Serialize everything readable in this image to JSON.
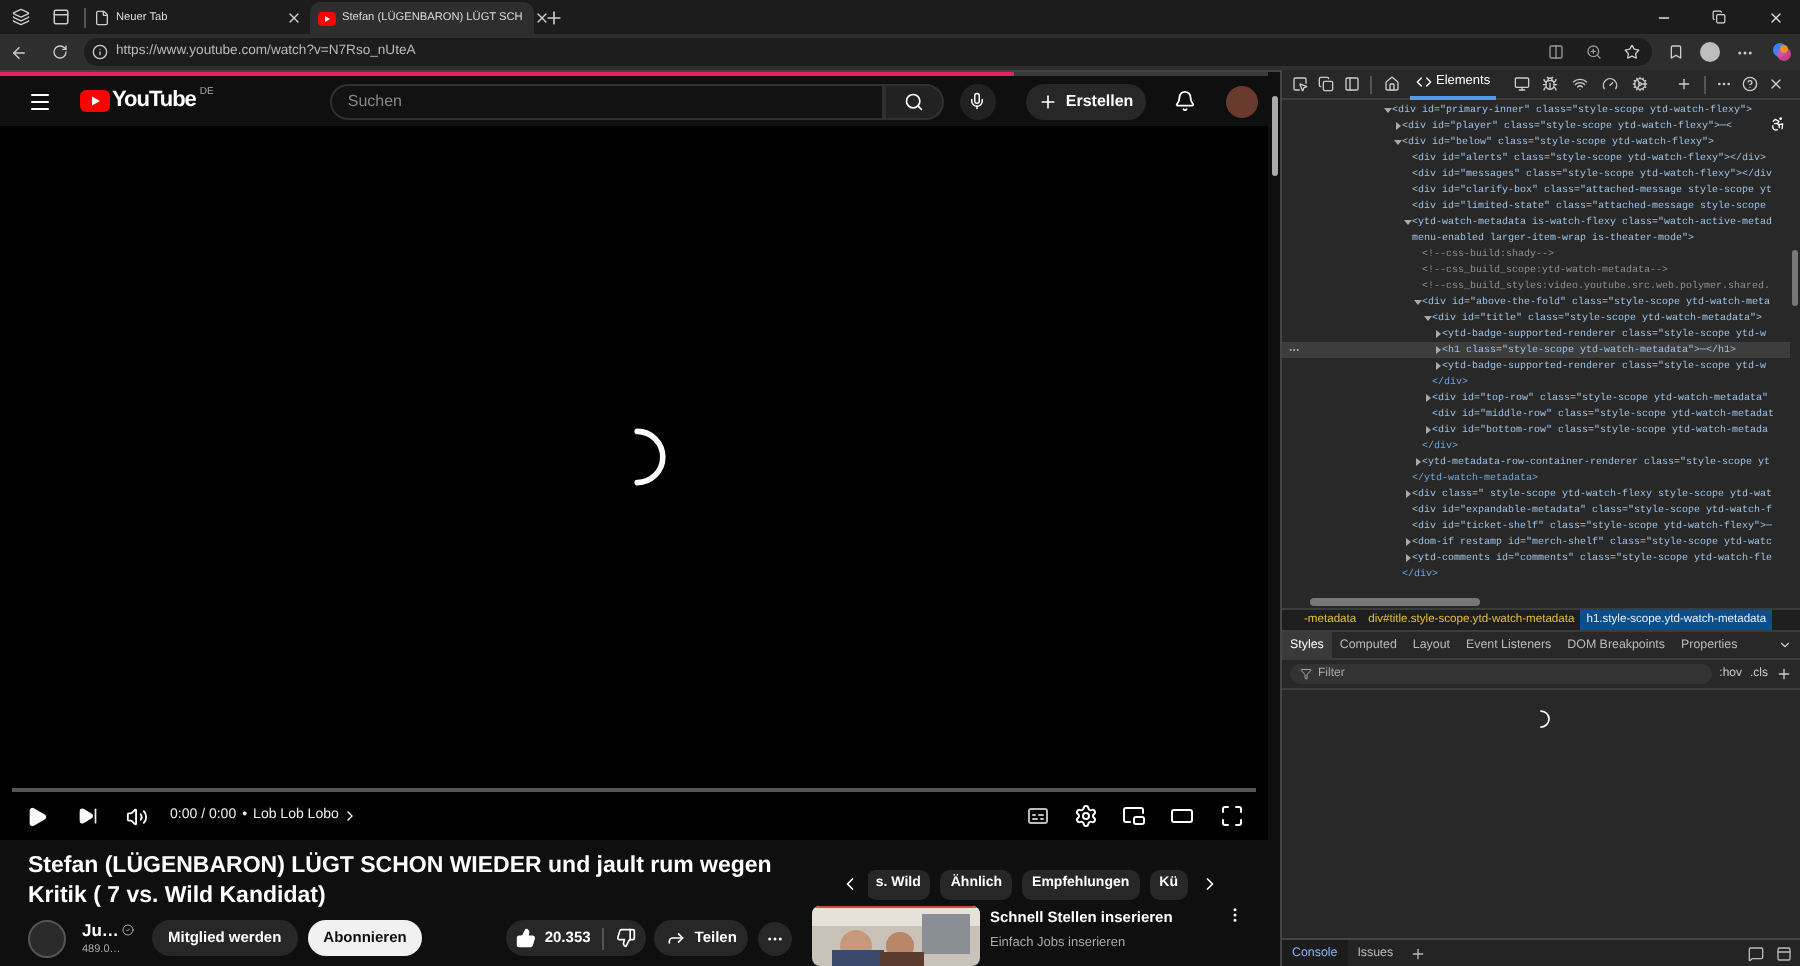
{
  "browser": {
    "tabs": [
      {
        "title": "Neuer Tab",
        "selected": false,
        "kind": "blank"
      },
      {
        "title": "Stefan (LÜGENBARON) LÜGT SCH",
        "selected": true,
        "kind": "youtube"
      }
    ],
    "url": "https://www.youtube.com/watch?v=N7Rso_nUteA"
  },
  "page_loading_bar": {
    "level": 0.8
  },
  "youtube": {
    "logo_text": "YouTube",
    "logo_region": "DE",
    "search_placeholder": "Suchen",
    "create_label": "Erstellen",
    "time": "0:00 / 0:00",
    "separator": "•",
    "chapter": "Lob Lob Lobo",
    "title": "Stefan (LÜGENBARON) LÜGT SCHON WIEDER und jault rum wegen Kritik ( 7 vs. Wild Kandidat)",
    "channel_name": "Ju…",
    "subscribers": "489.0…",
    "join_label": "Mitglied werden",
    "subscribe_label": "Abonnieren",
    "likes": "20.353",
    "share_label": "Teilen",
    "chips": [
      {
        "label": "s. Wild",
        "selected": false
      },
      {
        "label": "Ähnlich",
        "selected": false
      },
      {
        "label": "Empfehlungen",
        "selected": false
      },
      {
        "label": "Kü",
        "selected": false
      }
    ],
    "recommendation": {
      "title": "Schnell Stellen inserieren",
      "subtitle": "Einfach Jobs inserieren"
    }
  },
  "devtools": {
    "tabs": [
      {
        "label": "Elements",
        "selected": true
      }
    ],
    "tree": [
      {
        "kind": "element",
        "text": "<div id=\"primary-inner\" class=\"style-scope ytd-watch-flexy\">",
        "expanded": true,
        "selected": false,
        "children": [
          {
            "kind": "element",
            "text": "<div id=\"player\" class=\"style-scope ytd-watch-flexy\">⋯<",
            "expanded": false,
            "selected": false
          },
          {
            "kind": "element",
            "text": "<div id=\"below\" class=\"style-scope ytd-watch-flexy\">",
            "expanded": true,
            "selected": false,
            "children": [
              {
                "kind": "element",
                "text": "<div id=\"alerts\" class=\"style-scope ytd-watch-flexy\"></div>",
                "selected": false
              },
              {
                "kind": "element",
                "text": "<div id=\"messages\" class=\"style-scope ytd-watch-flexy\"></div",
                "selected": false
              },
              {
                "kind": "element",
                "text": "<div id=\"clarify-box\" class=\"attached-message style-scope yt",
                "selected": false
              },
              {
                "kind": "element",
                "text": "<div id=\"limited-state\" class=\"attached-message style-scope",
                "selected": false
              },
              {
                "kind": "element",
                "text": "<ytd-watch-metadata is-watch-flexy class=\"watch-active-metad",
                "continuation": "menu-enabled larger-item-wrap is-theater-mode\">",
                "expanded": true,
                "selected": false,
                "children": [
                  {
                    "kind": "comment",
                    "text": "<!--css-build:shady-->",
                    "selected": false
                  },
                  {
                    "kind": "comment",
                    "text": "<!--css_build_scope:ytd-watch-metadata-->",
                    "selected": false
                  },
                  {
                    "kind": "comment",
                    "text": "<!--css_build_styles:video.youtube.src.web.polymer.shared.",
                    "selected": false
                  },
                  {
                    "kind": "element",
                    "text": "<div id=\"above-the-fold\" class=\"style-scope ytd-watch-meta",
                    "expanded": true,
                    "selected": false,
                    "children": [
                      {
                        "kind": "element",
                        "text": "<div id=\"title\" class=\"style-scope ytd-watch-metadata\">",
                        "expanded": true,
                        "selected": false,
                        "children": [
                          {
                            "kind": "element",
                            "text": "<ytd-badge-supported-renderer class=\"style-scope ytd-w",
                            "expanded": false,
                            "selected": false
                          },
                          {
                            "kind": "element",
                            "text": "<h1 class=\"style-scope ytd-watch-metadata\">⋯</h1>",
                            "expanded": false,
                            "selected": true
                          },
                          {
                            "kind": "element",
                            "text": "<ytd-badge-supported-renderer class=\"style-scope ytd-w",
                            "expanded": false,
                            "selected": false
                          }
                        ]
                      },
                      {
                        "kind": "closing",
                        "text": "</div>",
                        "selected": false
                      },
                      {
                        "kind": "element",
                        "text": "<div id=\"top-row\" class=\"style-scope ytd-watch-metadata\"",
                        "expanded": false,
                        "selected": false
                      },
                      {
                        "kind": "element",
                        "text": "<div id=\"middle-row\" class=\"style-scope ytd-watch-metadat",
                        "selected": false
                      },
                      {
                        "kind": "element",
                        "text": "<div id=\"bottom-row\" class=\"style-scope ytd-watch-metada",
                        "expanded": false,
                        "selected": false
                      }
                    ]
                  },
                  {
                    "kind": "closing",
                    "text": "</div>",
                    "selected": false
                  },
                  {
                    "kind": "element",
                    "text": "<ytd-metadata-row-container-renderer class=\"style-scope yt",
                    "expanded": false,
                    "selected": false
                  }
                ]
              },
              {
                "kind": "closing",
                "text": "</ytd-watch-metadata>",
                "selected": false
              },
              {
                "kind": "element",
                "text": "<div class=\" style-scope ytd-watch-flexy style-scope ytd-wat",
                "expanded": false,
                "selected": false
              },
              {
                "kind": "element",
                "text": "<div id=\"expandable-metadata\" class=\"style-scope ytd-watch-f",
                "selected": false
              },
              {
                "kind": "element",
                "text": "<div id=\"ticket-shelf\" class=\"style-scope ytd-watch-flexy\">⋯",
                "selected": false
              },
              {
                "kind": "element",
                "text": "<dom-if restamp id=\"merch-shelf\" class=\"style-scope ytd-watc",
                "expanded": false,
                "selected": false
              },
              {
                "kind": "element",
                "text": "<ytd-comments id=\"comments\" class=\"style-scope ytd-watch-fle",
                "expanded": false,
                "selected": false
              }
            ]
          },
          {
            "kind": "closing",
            "text": "</div>",
            "selected": false
          }
        ]
      }
    ],
    "breadcrumbs": [
      {
        "label": "-metadata",
        "selected": false
      },
      {
        "label": "div#title.style-scope.ytd-watch-metadata",
        "selected": false
      },
      {
        "label": "h1.style-scope.ytd-watch-metadata",
        "selected": true
      }
    ],
    "style_tabs": [
      {
        "label": "Styles",
        "selected": true
      },
      {
        "label": "Computed",
        "selected": false
      },
      {
        "label": "Layout",
        "selected": false
      },
      {
        "label": "Event Listeners",
        "selected": false
      },
      {
        "label": "DOM Breakpoints",
        "selected": false
      },
      {
        "label": "Properties",
        "selected": false
      }
    ],
    "filter_placeholder": "Filter",
    "hov_label": ":hov",
    "cls_label": ".cls",
    "drawer_tabs": [
      {
        "label": "Console",
        "selected": true
      },
      {
        "label": "Issues",
        "selected": false
      }
    ]
  }
}
